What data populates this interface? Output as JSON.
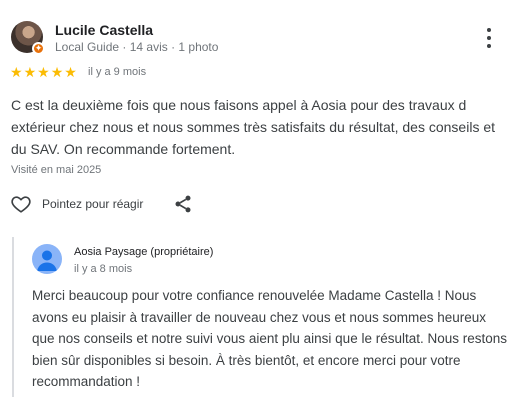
{
  "reviewer": {
    "name": "Lucile Castella",
    "meta": "Local Guide · 14 avis · 1 photo"
  },
  "review": {
    "rating": 5,
    "stars": [
      "★",
      "★",
      "★",
      "★",
      "★"
    ],
    "date": "il y a 9 mois",
    "text": "C est la deuxième fois que nous faisons appel à Aosia pour des travaux d extérieur chez nous et nous sommes très satisfaits du résultat, des conseils et du SAV. On recommande fortement.",
    "visited": "Visité en mai 2025"
  },
  "actions": {
    "like_label": "Pointez pour réagir",
    "like_icon": "heart-outline-icon",
    "share_icon": "share-icon",
    "more_icon": "more-vert-icon"
  },
  "owner_reply": {
    "name": "Aosia Paysage (propriétaire)",
    "date": "il y a 8 mois",
    "text": "Merci beaucoup pour votre confiance renouvelée Madame Castella ! Nous avons eu plaisir à travailler de nouveau chez vous et nous sommes heureux que nos conseils et notre suivi vous aient plu ainsi que le résultat. Nous restons bien sûr disponibles si besoin. À très bientôt, et encore merci pour votre recommandation !"
  },
  "colors": {
    "star": "#fbbc04",
    "guide_badge": "#e8710a",
    "owner_avatar": "#8ab4f8"
  }
}
